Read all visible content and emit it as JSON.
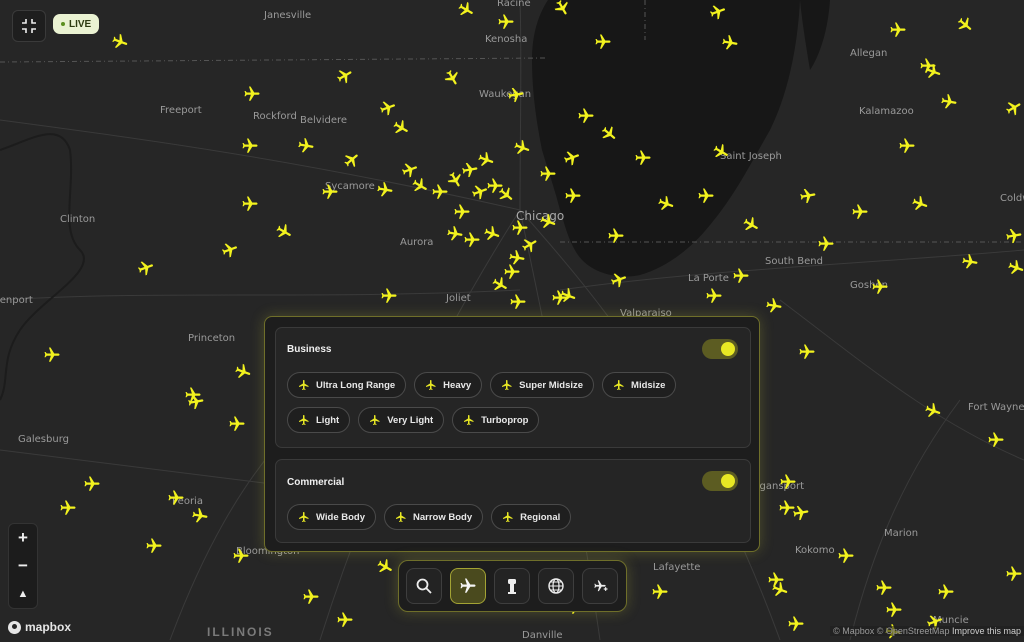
{
  "app": {
    "live_label": "LIVE",
    "fullscreen_icon": "collapse-fullscreen-icon"
  },
  "map": {
    "state_label": "ILLINOIS",
    "cities": [
      "Janesville",
      "Racine",
      "Kenosha",
      "Allegan",
      "Waukegan",
      "Freeport",
      "Rockford",
      "Belvidere",
      "Kalamazoo",
      "Sycamore",
      "Saint Joseph",
      "Chicago",
      "Clinton",
      "Aurora",
      "La Porte",
      "South Bend",
      "Goshen",
      "Joliet",
      "Valparaiso",
      "Princeton",
      "Coldwater",
      "Davenport",
      "Fort Wayne",
      "Galesburg",
      "Peoria",
      "Logansport",
      "Bloomington",
      "Kokomo",
      "Marion",
      "Lafayette",
      "Muncie",
      "Danville"
    ],
    "aircraft_color": "#f2f21e",
    "water_color": "#171717",
    "land_color": "#262626"
  },
  "filters": {
    "business": {
      "title": "Business",
      "enabled": true,
      "chips": [
        "Ultra Long Range",
        "Heavy",
        "Super Midsize",
        "Midsize",
        "Light",
        "Very Light",
        "Turboprop"
      ]
    },
    "commercial": {
      "title": "Commercial",
      "enabled": true,
      "chips": [
        "Wide Body",
        "Narrow Body",
        "Regional"
      ]
    },
    "accent_color": "#e8e824"
  },
  "dock": {
    "buttons": [
      {
        "icon": "search-icon",
        "active": false
      },
      {
        "icon": "airplane-icon",
        "active": true
      },
      {
        "icon": "control-tower-icon",
        "active": false
      },
      {
        "icon": "globe-icon",
        "active": false
      },
      {
        "icon": "airplane-route-icon",
        "active": false
      }
    ]
  },
  "controls": {
    "zoom_in": "+",
    "zoom_out": "−",
    "compass": "▲",
    "logo": "mapbox"
  },
  "attribution": {
    "text": "© Mapbox © OpenStreetMap",
    "improve": "Improve this map"
  }
}
